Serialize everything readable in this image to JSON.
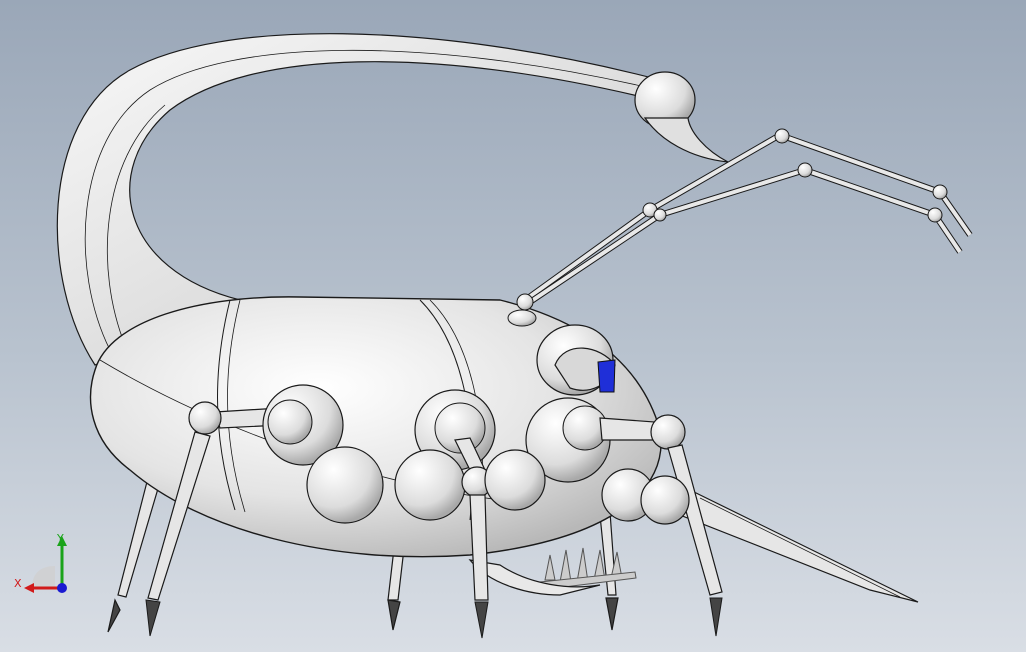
{
  "viewport": {
    "background_top": "#9aa7b8",
    "background_bottom": "#d9dee5",
    "model_fill": "#ededed",
    "model_edge": "#1a1a1a",
    "eye_color": "#1f2fd8"
  },
  "triad": {
    "x_label": "X",
    "y_label": "Y",
    "x_color": "#d11a1a",
    "y_color": "#1aa31a",
    "z_color": "#1a1ad1"
  }
}
